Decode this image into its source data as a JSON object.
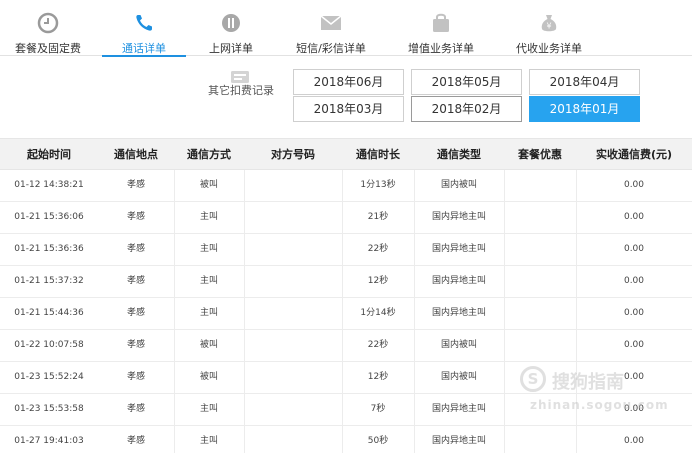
{
  "tabs": [
    {
      "label": "套餐及固定费",
      "icon": "clock-icon",
      "active": false
    },
    {
      "label": "通话详单",
      "icon": "phone-icon",
      "active": true
    },
    {
      "label": "上网详单",
      "icon": "globe-icon",
      "active": false
    },
    {
      "label": "短信/彩信详单",
      "icon": "envelope-icon",
      "active": false
    },
    {
      "label": "增值业务详单",
      "icon": "bag-icon",
      "active": false
    },
    {
      "label": "代收业务详单",
      "icon": "money-bag-icon",
      "active": false
    }
  ],
  "accent_color": "#27a3ef",
  "period": {
    "label": "其它扣费记录",
    "months": [
      "2018年06月",
      "2018年05月",
      "2018年04月",
      "2018年03月",
      "2018年02月",
      "2018年01月"
    ],
    "selected": "2018年01月"
  },
  "table": {
    "headers": [
      "起始时间",
      "通信地点",
      "通信方式",
      "对方号码",
      "通信时长",
      "通信类型",
      "套餐优惠",
      "实收通信费(元)"
    ],
    "rows": [
      [
        "01-12 14:38:21",
        "孝感",
        "被叫",
        "",
        "1分13秒",
        "国内被叫",
        "",
        "0.00"
      ],
      [
        "01-21 15:36:06",
        "孝感",
        "主叫",
        "",
        "21秒",
        "国内异地主叫",
        "",
        "0.00"
      ],
      [
        "01-21 15:36:36",
        "孝感",
        "主叫",
        "",
        "22秒",
        "国内异地主叫",
        "",
        "0.00"
      ],
      [
        "01-21 15:37:32",
        "孝感",
        "主叫",
        "",
        "12秒",
        "国内异地主叫",
        "",
        "0.00"
      ],
      [
        "01-21 15:44:36",
        "孝感",
        "主叫",
        "",
        "1分14秒",
        "国内异地主叫",
        "",
        "0.00"
      ],
      [
        "01-22 10:07:58",
        "孝感",
        "被叫",
        "",
        "22秒",
        "国内被叫",
        "",
        "0.00"
      ],
      [
        "01-23 15:52:24",
        "孝感",
        "被叫",
        "",
        "12秒",
        "国内被叫",
        "",
        "0.00"
      ],
      [
        "01-23 15:53:58",
        "孝感",
        "主叫",
        "",
        "7秒",
        "国内异地主叫",
        "",
        "0.00"
      ],
      [
        "01-27 19:41:03",
        "孝感",
        "主叫",
        "",
        "50秒",
        "国内异地主叫",
        "",
        "0.00"
      ]
    ]
  },
  "watermark": {
    "cn": "搜狗指南",
    "en": "zhinan.sogou.com"
  }
}
